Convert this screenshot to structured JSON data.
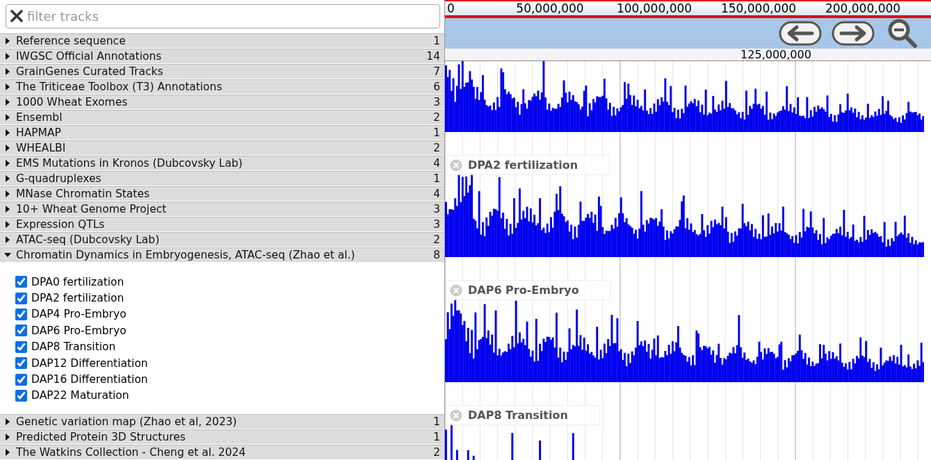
{
  "filter": {
    "placeholder": "filter tracks"
  },
  "categories": [
    {
      "name": "Reference sequence",
      "count": "1",
      "expanded": false
    },
    {
      "name": "IWGSC Official Annotations",
      "count": "14",
      "expanded": false
    },
    {
      "name": "GrainGenes Curated Tracks",
      "count": "7",
      "expanded": false
    },
    {
      "name": "The Triticeae Toolbox (T3) Annotations",
      "count": "6",
      "expanded": false
    },
    {
      "name": "1000 Wheat Exomes",
      "count": "3",
      "expanded": false
    },
    {
      "name": "Ensembl",
      "count": "2",
      "expanded": false
    },
    {
      "name": "HAPMAP",
      "count": "1",
      "expanded": false
    },
    {
      "name": "WHEALBI",
      "count": "2",
      "expanded": false
    },
    {
      "name": "EMS Mutations in Kronos (Dubcovsky Lab)",
      "count": "4",
      "expanded": false
    },
    {
      "name": "G-quadruplexes",
      "count": "1",
      "expanded": false
    },
    {
      "name": "MNase Chromatin States",
      "count": "4",
      "expanded": false
    },
    {
      "name": "10+ Wheat Genome Project",
      "count": "3",
      "expanded": false
    },
    {
      "name": "Expression QTLs",
      "count": "3",
      "expanded": false
    },
    {
      "name": "ATAC-seq (Dubcovsky Lab)",
      "count": "2",
      "expanded": false
    },
    {
      "name": "Chromatin Dynamics in Embryogenesis, ATAC-seq (Zhao et al.)",
      "count": "8",
      "expanded": true,
      "tracks": [
        {
          "label": "DPA0 fertilization",
          "checked": true
        },
        {
          "label": "DPA2 fertilization",
          "checked": true
        },
        {
          "label": "DAP4 Pro-Embryo",
          "checked": true
        },
        {
          "label": "DAP6 Pro-Embryo",
          "checked": true
        },
        {
          "label": "DAP8 Transition",
          "checked": true
        },
        {
          "label": "DAP12 Differentiation",
          "checked": true
        },
        {
          "label": "DAP16 Differentiation",
          "checked": true
        },
        {
          "label": "DAP22 Maturation",
          "checked": true
        }
      ]
    },
    {
      "name": "Genetic variation map (Zhao et al, 2023)",
      "count": "1",
      "expanded": false
    },
    {
      "name": "Predicted Protein 3D Structures",
      "count": "1",
      "expanded": false
    },
    {
      "name": "The Watkins Collection - Cheng et al. 2024",
      "count": "2",
      "expanded": false
    }
  ],
  "overview_ruler": [
    "0",
    "50,000,000",
    "100,000,000",
    "150,000,000",
    "200,000,000"
  ],
  "detail_ruler": [
    "125,000,000"
  ],
  "tracks": [
    {
      "kind": "unlabeled"
    },
    {
      "label": "DPA2 fertilization"
    },
    {
      "label": "DAP6 Pro-Embryo"
    },
    {
      "label": "DAP8 Transition"
    }
  ]
}
